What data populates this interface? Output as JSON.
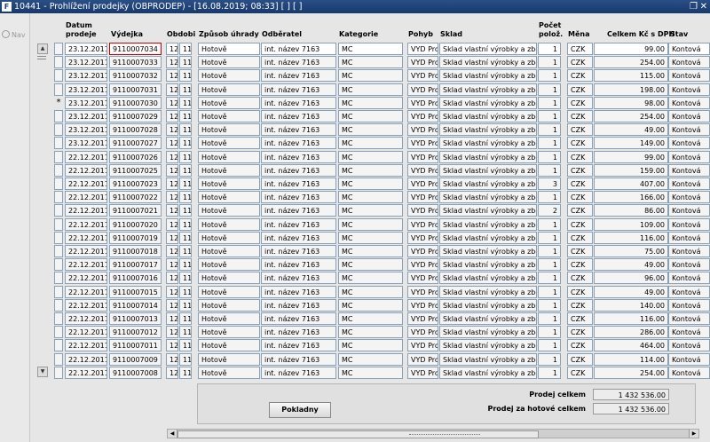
{
  "window": {
    "app_icon": "F",
    "title": "10441 - Prohlížení prodejky (OBPRODEP) - [16.08.2019; 08:33]  [ ]  [ ]",
    "restore_icon": "restore-icon",
    "close_icon": "close-icon"
  },
  "nav": {
    "label": "Nav"
  },
  "columns": {
    "datum": "Datum\nprodeje",
    "vydejka": "Výdejka",
    "obdobi": "Obdobi",
    "zpusob": "Způsob úhrady",
    "odberatel": "Odběratel",
    "kategorie": "Kategorie",
    "pohyb": "Pohyb",
    "sklad": "Sklad",
    "pocet": "Počet\npolož.",
    "mena": "Měna",
    "celkem": "Celkem Kč s DPH",
    "stav": "Stav"
  },
  "current_row_marker": "*",
  "rows": [
    {
      "datum": "23.12.2011",
      "vydejka": "9110007034",
      "o1": "12",
      "o2": "11",
      "zpusob": "Hotově",
      "odberatel": "int. název 7163",
      "kategorie": "MC",
      "pohyb": "VYD Pro",
      "sklad": "Sklad vlastní výrobky a zboží",
      "pocet": "1",
      "mena": "CZK",
      "celkem": "99.00",
      "stav": "Kontová"
    },
    {
      "datum": "23.12.2011",
      "vydejka": "9110007033",
      "o1": "12",
      "o2": "11",
      "zpusob": "Hotově",
      "odberatel": "int. název 7163",
      "kategorie": "MC",
      "pohyb": "VYD Pro",
      "sklad": "Sklad vlastní výrobky a zboží",
      "pocet": "1",
      "mena": "CZK",
      "celkem": "254.00",
      "stav": "Kontová"
    },
    {
      "datum": "23.12.2011",
      "vydejka": "9110007032",
      "o1": "12",
      "o2": "11",
      "zpusob": "Hotově",
      "odberatel": "int. název 7163",
      "kategorie": "MC",
      "pohyb": "VYD Pro",
      "sklad": "Sklad vlastní výrobky a zboží",
      "pocet": "1",
      "mena": "CZK",
      "celkem": "115.00",
      "stav": "Kontová"
    },
    {
      "datum": "23.12.2011",
      "vydejka": "9110007031",
      "o1": "12",
      "o2": "11",
      "zpusob": "Hotově",
      "odberatel": "int. název 7163",
      "kategorie": "MC",
      "pohyb": "VYD Pro",
      "sklad": "Sklad vlastní výrobky a zboží",
      "pocet": "1",
      "mena": "CZK",
      "celkem": "198.00",
      "stav": "Kontová"
    },
    {
      "datum": "23.12.2011",
      "vydejka": "9110007030",
      "o1": "12",
      "o2": "11",
      "zpusob": "Hotově",
      "odberatel": "int. název 7163",
      "kategorie": "MC",
      "pohyb": "VYD Pro",
      "sklad": "Sklad vlastní výrobky a zboží",
      "pocet": "1",
      "mena": "CZK",
      "celkem": "98.00",
      "stav": "Kontová"
    },
    {
      "datum": "23.12.2011",
      "vydejka": "9110007029",
      "o1": "12",
      "o2": "11",
      "zpusob": "Hotově",
      "odberatel": "int. název 7163",
      "kategorie": "MC",
      "pohyb": "VYD Pro",
      "sklad": "Sklad vlastní výrobky a zboží",
      "pocet": "1",
      "mena": "CZK",
      "celkem": "254.00",
      "stav": "Kontová"
    },
    {
      "datum": "23.12.2011",
      "vydejka": "9110007028",
      "o1": "12",
      "o2": "11",
      "zpusob": "Hotově",
      "odberatel": "int. název 7163",
      "kategorie": "MC",
      "pohyb": "VYD Pro",
      "sklad": "Sklad vlastní výrobky a zboží",
      "pocet": "1",
      "mena": "CZK",
      "celkem": "49.00",
      "stav": "Kontová"
    },
    {
      "datum": "23.12.2011",
      "vydejka": "9110007027",
      "o1": "12",
      "o2": "11",
      "zpusob": "Hotově",
      "odberatel": "int. název 7163",
      "kategorie": "MC",
      "pohyb": "VYD Pro",
      "sklad": "Sklad vlastní výrobky a zboží",
      "pocet": "1",
      "mena": "CZK",
      "celkem": "149.00",
      "stav": "Kontová"
    },
    {
      "datum": "22.12.2011",
      "vydejka": "9110007026",
      "o1": "12",
      "o2": "11",
      "zpusob": "Hotově",
      "odberatel": "int. název 7163",
      "kategorie": "MC",
      "pohyb": "VYD Pro",
      "sklad": "Sklad vlastní výrobky a zboží",
      "pocet": "1",
      "mena": "CZK",
      "celkem": "99.00",
      "stav": "Kontová"
    },
    {
      "datum": "22.12.2011",
      "vydejka": "9110007025",
      "o1": "12",
      "o2": "11",
      "zpusob": "Hotově",
      "odberatel": "int. název 7163",
      "kategorie": "MC",
      "pohyb": "VYD Pro",
      "sklad": "Sklad vlastní výrobky a zboží",
      "pocet": "1",
      "mena": "CZK",
      "celkem": "159.00",
      "stav": "Kontová"
    },
    {
      "datum": "22.12.2011",
      "vydejka": "9110007023",
      "o1": "12",
      "o2": "11",
      "zpusob": "Hotově",
      "odberatel": "int. název 7163",
      "kategorie": "MC",
      "pohyb": "VYD Pro",
      "sklad": "Sklad vlastní výrobky a zboží",
      "pocet": "3",
      "mena": "CZK",
      "celkem": "407.00",
      "stav": "Kontová"
    },
    {
      "datum": "22.12.2011",
      "vydejka": "9110007022",
      "o1": "12",
      "o2": "11",
      "zpusob": "Hotově",
      "odberatel": "int. název 7163",
      "kategorie": "MC",
      "pohyb": "VYD Pro",
      "sklad": "Sklad vlastní výrobky a zboží",
      "pocet": "1",
      "mena": "CZK",
      "celkem": "166.00",
      "stav": "Kontová"
    },
    {
      "datum": "22.12.2011",
      "vydejka": "9110007021",
      "o1": "12",
      "o2": "11",
      "zpusob": "Hotově",
      "odberatel": "int. název 7163",
      "kategorie": "MC",
      "pohyb": "VYD Pro",
      "sklad": "Sklad vlastní výrobky a zboží",
      "pocet": "2",
      "mena": "CZK",
      "celkem": "86.00",
      "stav": "Kontová"
    },
    {
      "datum": "22.12.2011",
      "vydejka": "9110007020",
      "o1": "12",
      "o2": "11",
      "zpusob": "Hotově",
      "odberatel": "int. název 7163",
      "kategorie": "MC",
      "pohyb": "VYD Pro",
      "sklad": "Sklad vlastní výrobky a zboží",
      "pocet": "1",
      "mena": "CZK",
      "celkem": "109.00",
      "stav": "Kontová"
    },
    {
      "datum": "22.12.2011",
      "vydejka": "9110007019",
      "o1": "12",
      "o2": "11",
      "zpusob": "Hotově",
      "odberatel": "int. název 7163",
      "kategorie": "MC",
      "pohyb": "VYD Pro",
      "sklad": "Sklad vlastní výrobky a zboží",
      "pocet": "1",
      "mena": "CZK",
      "celkem": "116.00",
      "stav": "Kontová"
    },
    {
      "datum": "22.12.2011",
      "vydejka": "9110007018",
      "o1": "12",
      "o2": "11",
      "zpusob": "Hotově",
      "odberatel": "int. název 7163",
      "kategorie": "MC",
      "pohyb": "VYD Pro",
      "sklad": "Sklad vlastní výrobky a zboží",
      "pocet": "1",
      "mena": "CZK",
      "celkem": "75.00",
      "stav": "Kontová"
    },
    {
      "datum": "22.12.2011",
      "vydejka": "9110007017",
      "o1": "12",
      "o2": "11",
      "zpusob": "Hotově",
      "odberatel": "int. název 7163",
      "kategorie": "MC",
      "pohyb": "VYD Pro",
      "sklad": "Sklad vlastní výrobky a zboží",
      "pocet": "1",
      "mena": "CZK",
      "celkem": "49.00",
      "stav": "Kontová"
    },
    {
      "datum": "22.12.2011",
      "vydejka": "9110007016",
      "o1": "12",
      "o2": "11",
      "zpusob": "Hotově",
      "odberatel": "int. název 7163",
      "kategorie": "MC",
      "pohyb": "VYD Pro",
      "sklad": "Sklad vlastní výrobky a zboží",
      "pocet": "1",
      "mena": "CZK",
      "celkem": "96.00",
      "stav": "Kontová"
    },
    {
      "datum": "22.12.2011",
      "vydejka": "9110007015",
      "o1": "12",
      "o2": "11",
      "zpusob": "Hotově",
      "odberatel": "int. název 7163",
      "kategorie": "MC",
      "pohyb": "VYD Pro",
      "sklad": "Sklad vlastní výrobky a zboží",
      "pocet": "1",
      "mena": "CZK",
      "celkem": "49.00",
      "stav": "Kontová"
    },
    {
      "datum": "22.12.2011",
      "vydejka": "9110007014",
      "o1": "12",
      "o2": "11",
      "zpusob": "Hotově",
      "odberatel": "int. název 7163",
      "kategorie": "MC",
      "pohyb": "VYD Pro",
      "sklad": "Sklad vlastní výrobky a zboží",
      "pocet": "1",
      "mena": "CZK",
      "celkem": "140.00",
      "stav": "Kontová"
    },
    {
      "datum": "22.12.2011",
      "vydejka": "9110007013",
      "o1": "12",
      "o2": "11",
      "zpusob": "Hotově",
      "odberatel": "int. název 7163",
      "kategorie": "MC",
      "pohyb": "VYD Pro",
      "sklad": "Sklad vlastní výrobky a zboží",
      "pocet": "1",
      "mena": "CZK",
      "celkem": "116.00",
      "stav": "Kontová"
    },
    {
      "datum": "22.12.2011",
      "vydejka": "9110007012",
      "o1": "12",
      "o2": "11",
      "zpusob": "Hotově",
      "odberatel": "int. název 7163",
      "kategorie": "MC",
      "pohyb": "VYD Pro",
      "sklad": "Sklad vlastní výrobky a zboží",
      "pocet": "1",
      "mena": "CZK",
      "celkem": "286.00",
      "stav": "Kontová"
    },
    {
      "datum": "22.12.2011",
      "vydejka": "9110007011",
      "o1": "12",
      "o2": "11",
      "zpusob": "Hotově",
      "odberatel": "int. název 7163",
      "kategorie": "MC",
      "pohyb": "VYD Pro",
      "sklad": "Sklad vlastní výrobky a zboží",
      "pocet": "1",
      "mena": "CZK",
      "celkem": "464.00",
      "stav": "Kontová"
    },
    {
      "datum": "22.12.2011",
      "vydejka": "9110007009",
      "o1": "12",
      "o2": "11",
      "zpusob": "Hotově",
      "odberatel": "int. název 7163",
      "kategorie": "MC",
      "pohyb": "VYD Pro",
      "sklad": "Sklad vlastní výrobky a zboží",
      "pocet": "1",
      "mena": "CZK",
      "celkem": "114.00",
      "stav": "Kontová"
    },
    {
      "datum": "22.12.2011",
      "vydejka": "9110007008",
      "o1": "12",
      "o2": "11",
      "zpusob": "Hotově",
      "odberatel": "int. název 7163",
      "kategorie": "MC",
      "pohyb": "VYD Pro",
      "sklad": "Sklad vlastní výrobky a zboží",
      "pocet": "1",
      "mena": "CZK",
      "celkem": "254.00",
      "stav": "Kontová"
    }
  ],
  "footer": {
    "pokladny_label": "Pokladny",
    "prodej_celkem_label": "Prodej celkem",
    "prodej_celkem_value": "1 432 536.00",
    "prodej_hotove_label": "Prodej za hotové celkem",
    "prodej_hotove_value": "1 432 536.00"
  }
}
